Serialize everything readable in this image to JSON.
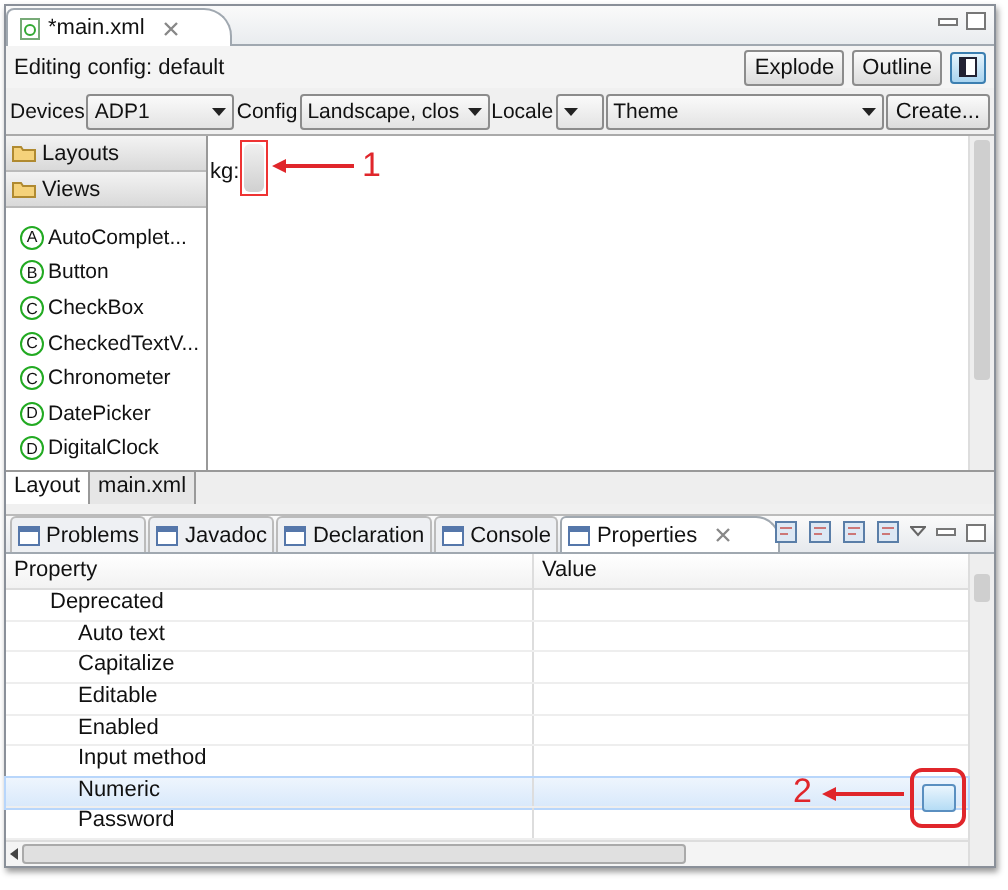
{
  "editor_tab": {
    "title": "*main.xml"
  },
  "config_bar": {
    "label": "Editing config: default",
    "buttons": [
      "Explode",
      "Outline"
    ]
  },
  "device_bar": [
    {
      "label": "Devices",
      "value": "ADP1"
    },
    {
      "label": "Config",
      "value": "Landscape, clos"
    },
    {
      "label": "Locale"
    },
    {
      "value": "Theme"
    }
  ],
  "create_button": "Create...",
  "palette": {
    "groups": [
      "Layouts",
      "Views"
    ],
    "items": [
      {
        "icon": "A",
        "label": "AutoComplet..."
      },
      {
        "icon": "B",
        "label": "Button"
      },
      {
        "icon": "C",
        "label": "CheckBox"
      },
      {
        "icon": "C",
        "label": "CheckedTextV..."
      },
      {
        "icon": "C",
        "label": "Chronometer"
      },
      {
        "icon": "D",
        "label": "DatePicker"
      },
      {
        "icon": "D",
        "label": "DigitalClock"
      }
    ]
  },
  "canvas": {
    "label": "kg:",
    "callout": "1"
  },
  "editor_tabs": [
    {
      "label": "Layout",
      "selected": true
    },
    {
      "label": "main.xml",
      "selected": false
    }
  ],
  "view_tabs": [
    {
      "label": "Problems",
      "selected": false
    },
    {
      "label": "Javadoc",
      "selected": false
    },
    {
      "label": "Declaration",
      "selected": false
    },
    {
      "label": "Console",
      "selected": false
    },
    {
      "label": "Properties",
      "selected": true
    }
  ],
  "properties": {
    "columns": [
      "Property",
      "Value"
    ],
    "rows": [
      {
        "name": "Deprecated",
        "selected": false,
        "children": [
          {
            "name": "Auto text",
            "selected": false
          },
          {
            "name": "Capitalize",
            "selected": false
          },
          {
            "name": "Editable",
            "selected": false
          },
          {
            "name": "Enabled",
            "selected": false
          },
          {
            "name": "Input method",
            "selected": false
          },
          {
            "name": "Numeric",
            "selected": true
          },
          {
            "name": "Password",
            "selected": false
          }
        ]
      }
    ],
    "callout": "2"
  }
}
